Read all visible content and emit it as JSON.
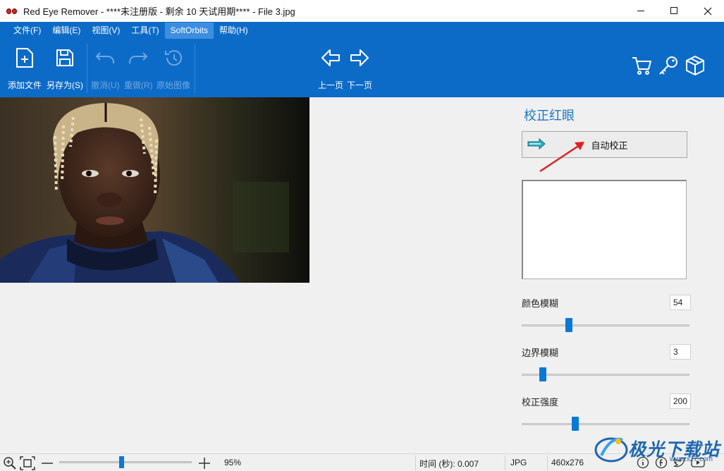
{
  "window": {
    "title": "Red Eye Remover - ****未注册版 - 剩余 10 天试用期**** - File 3.jpg"
  },
  "menu": [
    {
      "label": "文件(F)"
    },
    {
      "label": "编辑(E)"
    },
    {
      "label": "视图(V)"
    },
    {
      "label": "工具(T)"
    },
    {
      "label": "SoftOrbits"
    },
    {
      "label": "帮助(H)"
    }
  ],
  "toolbar": {
    "add_file": "添加文件",
    "save_as": "另存为(S)",
    "undo": "撤消(U)",
    "redo": "重做(R)",
    "original": "原始图像",
    "prev_page": "上一页",
    "next_page": "下一页"
  },
  "panel": {
    "title": "校正红眼",
    "auto_button": "自动校正",
    "sliders": [
      {
        "label": "颜色模糊",
        "value": "54",
        "fraction": 0.27
      },
      {
        "label": "边界模糊",
        "value": "3",
        "fraction": 0.11
      },
      {
        "label": "校正强度",
        "value": "200",
        "fraction": 0.31
      }
    ]
  },
  "status": {
    "zoom": "95%",
    "time": "时间 (秒): 0.007",
    "format": "JPG",
    "size": "460x276"
  },
  "watermark": {
    "text": "极光下载站",
    "sub": "www.xz7.com"
  },
  "colors": {
    "brand": "#0d6bc8",
    "accent": "#1a78c8",
    "slider": "#0a78d7"
  }
}
